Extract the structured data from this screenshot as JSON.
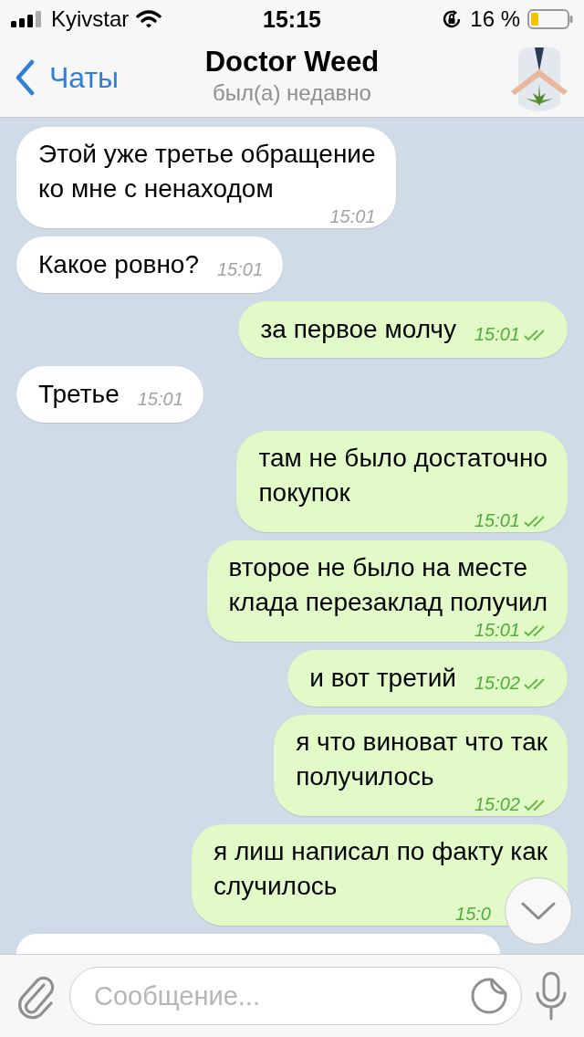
{
  "status_bar": {
    "carrier": "Kyivstar",
    "time": "15:15",
    "battery": "16 %"
  },
  "header": {
    "back": "Чаты",
    "title": "Doctor Weed",
    "subtitle": "был(а) недавно"
  },
  "messages": [
    {
      "kind": "incoming",
      "text": "Этой уже третье обращение\nко мне с ненаходом",
      "time": "15:01"
    },
    {
      "kind": "incoming",
      "text": "Какое ровно?",
      "time": "15:01"
    },
    {
      "kind": "outgoing",
      "text": "за первое молчу",
      "time": "15:01",
      "read": true
    },
    {
      "kind": "incoming",
      "text": "Третье",
      "time": "15:01"
    },
    {
      "kind": "outgoing",
      "text": "там не было достаточно\nпокупок",
      "time": "15:01",
      "read": true
    },
    {
      "kind": "outgoing",
      "text": "второе не было на месте\nклада перезаклад получил",
      "time": "15:01",
      "read": true
    },
    {
      "kind": "outgoing",
      "text": "и вот третий",
      "time": "15:02",
      "read": true
    },
    {
      "kind": "outgoing",
      "text": "я что виноват что так\nполучилось",
      "time": "15:02",
      "read": true
    },
    {
      "kind": "outgoing",
      "text": "я лиш написал по факту как\nслучилось",
      "time": "15:0"
    }
  ],
  "composer": {
    "placeholder": "Сообщение..."
  }
}
